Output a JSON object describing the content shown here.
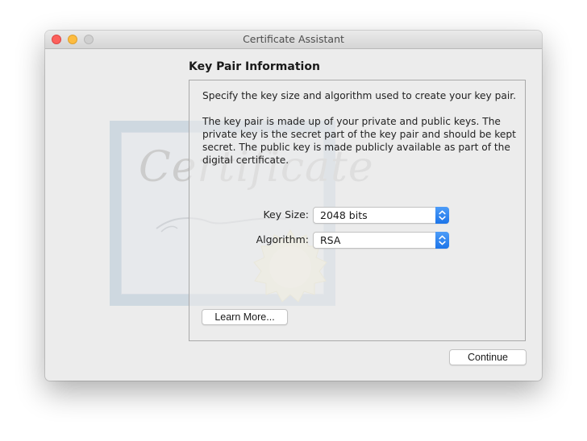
{
  "window": {
    "title": "Certificate Assistant",
    "controls": {
      "close": "close-button",
      "minimize": "minimize-button",
      "zoom": "zoom-button"
    }
  },
  "watermark": {
    "text": "Certificate"
  },
  "page": {
    "heading": "Key Pair Information",
    "instructions": "Specify the key size and algorithm used to create your key pair.",
    "description": "The key pair is made up of your private and public keys. The private key is the secret part of the key pair and should be kept secret. The public key is made publicly available as part of the digital certificate."
  },
  "form": {
    "key_size": {
      "label": "Key Size:",
      "value": "2048 bits"
    },
    "algorithm": {
      "label": "Algorithm:",
      "value": "RSA"
    }
  },
  "buttons": {
    "learn_more": "Learn More...",
    "continue": "Continue"
  },
  "colors": {
    "close": "#fc605c",
    "minimize": "#fdbc40",
    "zoom_disabled": "#d0d0d0",
    "accent": "#1d75e9"
  }
}
